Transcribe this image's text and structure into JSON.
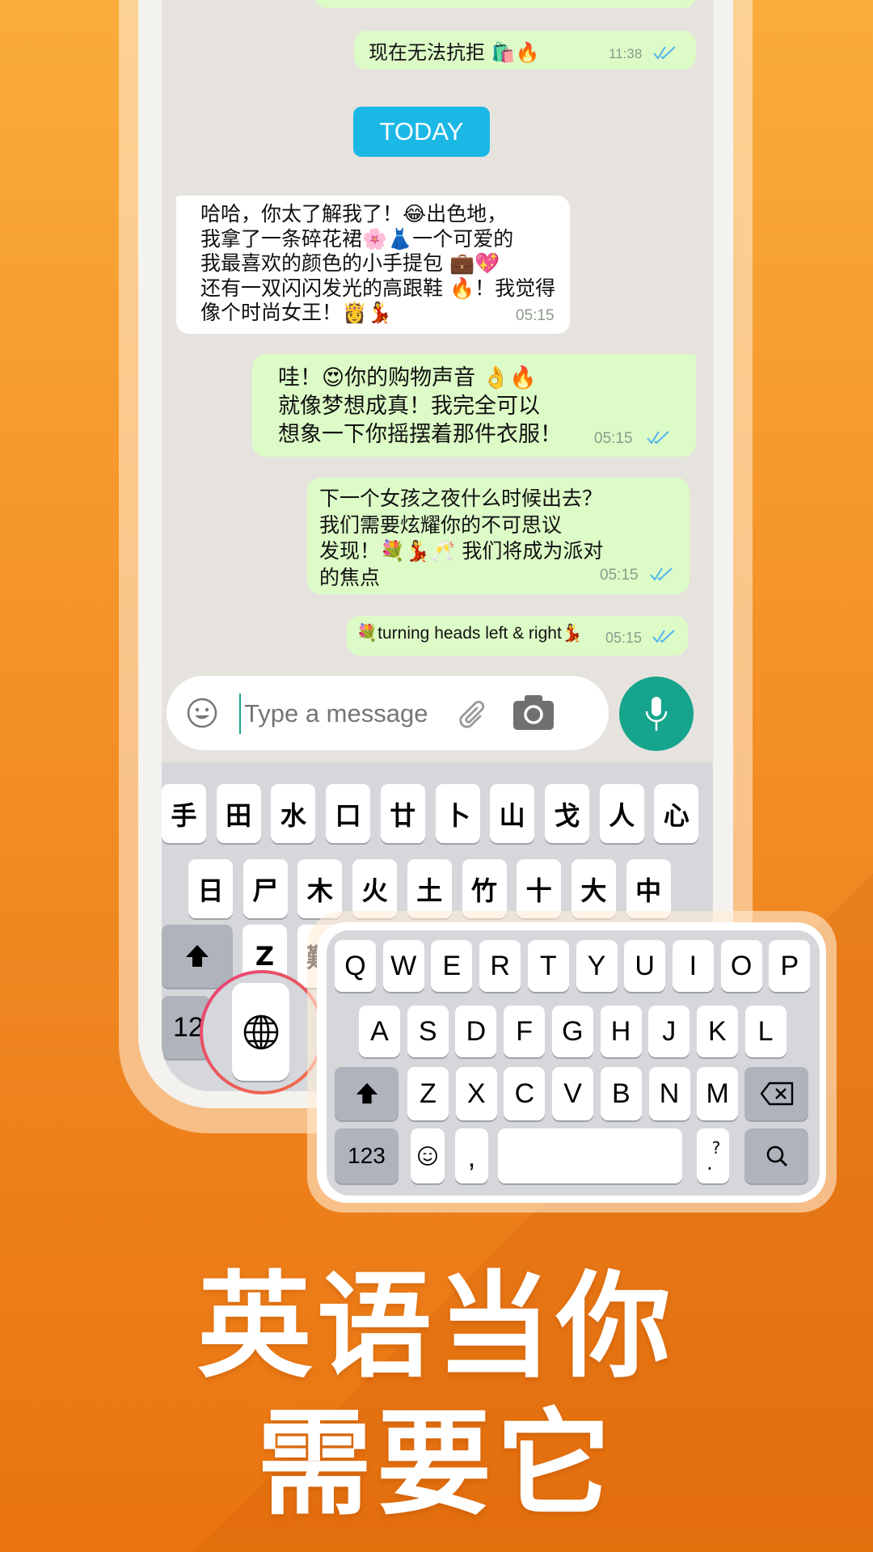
{
  "colors": {
    "accent_today": "#1BB8E6",
    "mic": "#16A58C",
    "sent_bubble": "#DDFBC7",
    "received_bubble": "#FFFFFF",
    "chat_bg": "#E6E3DF",
    "tick": "#4FB6EC"
  },
  "chat": {
    "date_divider": "TODAY",
    "messages": [
      {
        "side": "sent",
        "lines": [
          "现在无法抗拒 🛍️🔥"
        ],
        "time": "11:38",
        "ticks": "double-check-icon"
      },
      {
        "side": "received",
        "lines": [
          "哈哈，你太了解我了！😂出色地，",
          "我拿了一条碎花裙🌸👗一个可爱的",
          "我最喜欢的颜色的小手提包 💼💖",
          "还有一双闪闪发光的高跟鞋 🔥！我觉得",
          "像个时尚女王！👸💃"
        ],
        "time": "05:15"
      },
      {
        "side": "sent",
        "lines": [
          "哇！😍你的购物声音 👌🔥",
          "就像梦想成真！我完全可以",
          "想象一下你摇摆着那件衣服！"
        ],
        "time": "05:15",
        "ticks": "double-check-icon"
      },
      {
        "side": "sent",
        "lines": [
          "下一个女孩之夜什么时候出去？",
          "我们需要炫耀你的不可思议",
          "发现！💐💃🥂 我们将成为派对",
          "的焦点"
        ],
        "time": "05:15",
        "ticks": "double-check-icon"
      },
      {
        "side": "sent",
        "lines": [
          "💐turning heads left & right💃"
        ],
        "time": "05:15",
        "ticks": "double-check-icon"
      }
    ]
  },
  "composer": {
    "placeholder": "Type a message",
    "icons": [
      "emoji-icon",
      "paperclip-icon",
      "camera-icon",
      "microphone-icon"
    ]
  },
  "keyboard_cn": {
    "row1": [
      "手",
      "田",
      "水",
      "口",
      "廿",
      "卜",
      "山",
      "戈",
      "人",
      "心"
    ],
    "row2": [
      "日",
      "尸",
      "木",
      "火",
      "土",
      "竹",
      "十",
      "大",
      "中"
    ],
    "row3": [
      "Z",
      "難"
    ],
    "num_label": "12"
  },
  "keyboard_en": {
    "row1": [
      "Q",
      "W",
      "E",
      "R",
      "T",
      "Y",
      "U",
      "I",
      "O",
      "P"
    ],
    "row2": [
      "A",
      "S",
      "D",
      "F",
      "G",
      "H",
      "J",
      "K",
      "L"
    ],
    "row3": [
      "Z",
      "X",
      "C",
      "V",
      "B",
      "N",
      "M"
    ],
    "num_label": "123",
    "comma": ",",
    "punct_top": "?",
    "punct_bottom": "."
  },
  "headline": {
    "line1": "英语当你",
    "line2": "需要它"
  }
}
